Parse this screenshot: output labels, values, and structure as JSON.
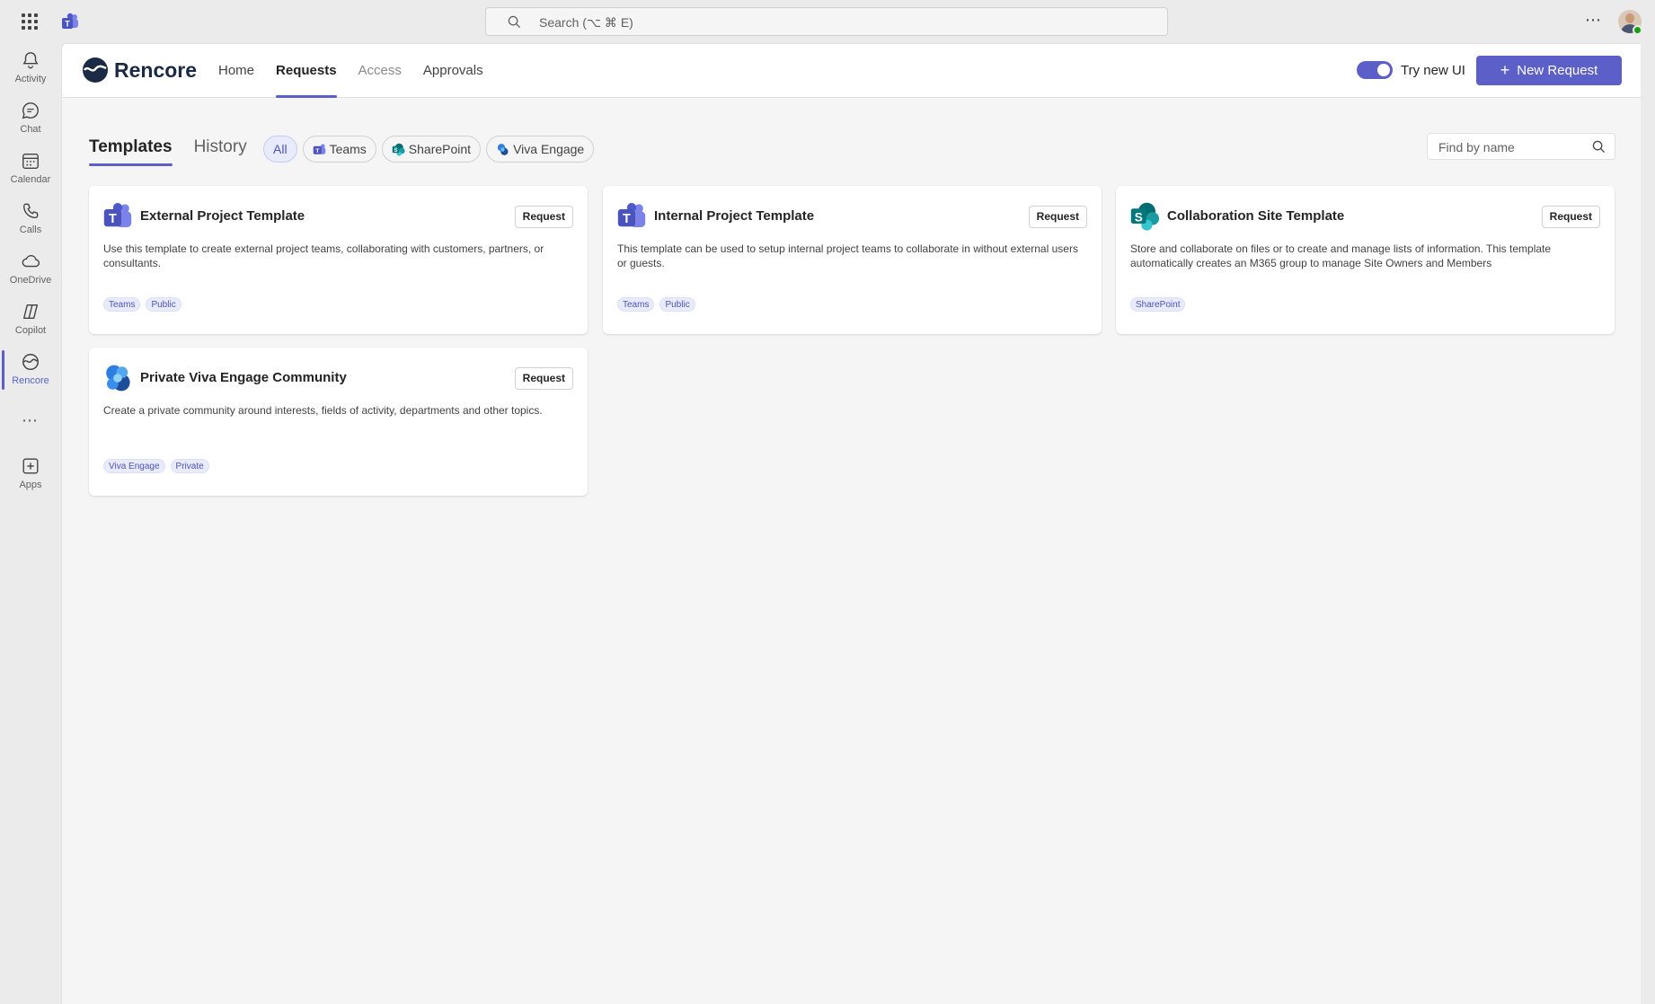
{
  "titlebar": {
    "search_placeholder": "Search (⌥ ⌘ E)",
    "more": "⋯"
  },
  "rail": {
    "items": [
      {
        "label": "Activity",
        "icon": "bell-icon"
      },
      {
        "label": "Chat",
        "icon": "chat-icon"
      },
      {
        "label": "Calendar",
        "icon": "calendar-icon"
      },
      {
        "label": "Calls",
        "icon": "phone-icon"
      },
      {
        "label": "OneDrive",
        "icon": "cloud-icon"
      },
      {
        "label": "Copilot",
        "icon": "copilot-icon"
      },
      {
        "label": "Rencore",
        "icon": "rencore-icon",
        "active": true
      },
      {
        "label": "Apps",
        "icon": "apps-add-icon"
      }
    ],
    "more": "⋯"
  },
  "app": {
    "brand": "Rencore",
    "nav": [
      "Home",
      "Requests",
      "Access",
      "Approvals"
    ],
    "active_nav": "Requests",
    "toggle_label": "Try new UI",
    "toggle_on": true,
    "new_request": "New Request",
    "accent": "#5b5fc7"
  },
  "toolbar": {
    "tabs": [
      "Templates",
      "History"
    ],
    "active_tab": "Templates",
    "filters": [
      "All",
      "Teams",
      "SharePoint",
      "Viva Engage"
    ],
    "active_filter": "All",
    "find_placeholder": "Find by name"
  },
  "cards": [
    {
      "title": "External Project Template",
      "button": "Request",
      "icon": "teams-icon",
      "description": "Use this template to create external project teams, collaborating with customers, partners, or consultants.",
      "tags": [
        "Teams",
        "Public"
      ]
    },
    {
      "title": "Internal Project Template",
      "button": "Request",
      "icon": "teams-icon",
      "description": "This template can be used to setup internal project teams to collaborate in without external users or guests.",
      "tags": [
        "Teams",
        "Public"
      ]
    },
    {
      "title": "Collaboration Site Template",
      "button": "Request",
      "icon": "sharepoint-icon",
      "description": "Store and collaborate on files or to create and manage lists of information. This template automatically creates an M365 group to manage Site Owners and Members",
      "tags": [
        "SharePoint"
      ]
    },
    {
      "title": "Private Viva Engage Community",
      "button": "Request",
      "icon": "viva-engage-icon",
      "description": "Create a private community around interests, fields of activity, departments and other topics.",
      "tags": [
        "Viva Engage",
        "Private"
      ]
    }
  ]
}
